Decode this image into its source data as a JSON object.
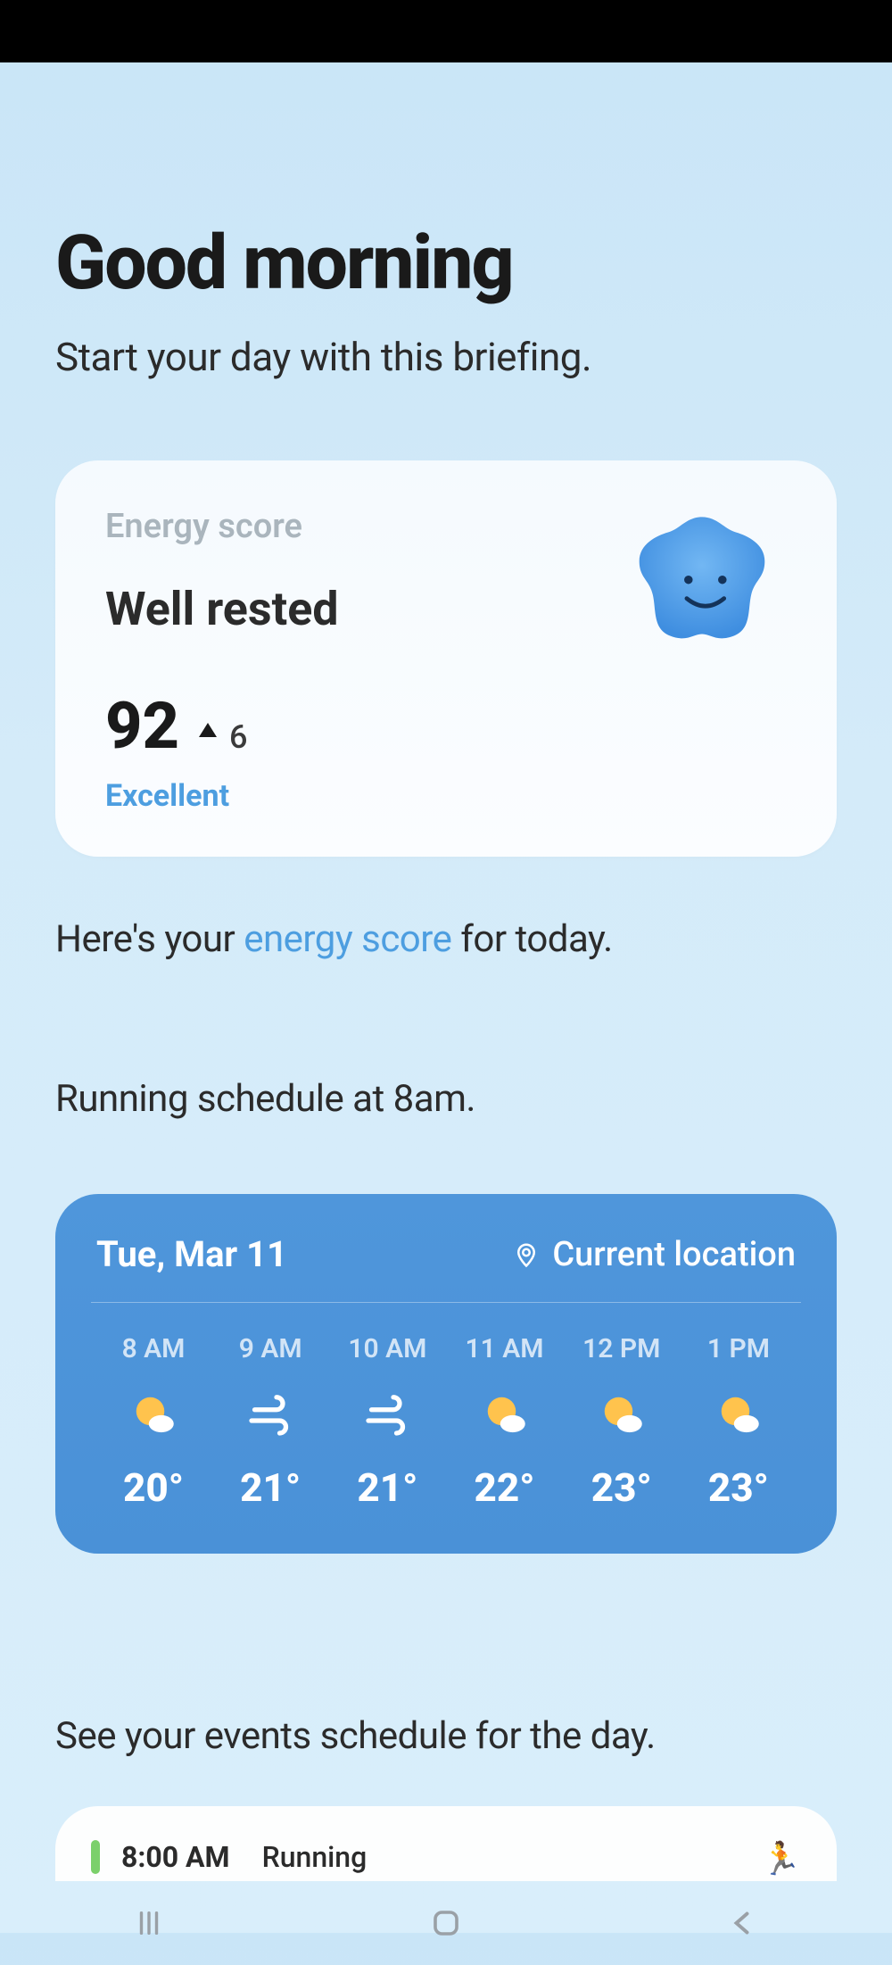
{
  "greeting": {
    "title": "Good morning",
    "subtitle": "Start your day with this briefing."
  },
  "energy_card": {
    "label": "Energy score",
    "title": "Well rested",
    "score": "92",
    "delta": "6",
    "rating": "Excellent"
  },
  "energy_line": {
    "prefix": "Here's your ",
    "link": "energy score",
    "suffix": " for today."
  },
  "running_line": "Running schedule at 8am.",
  "weather": {
    "date": "Tue, Mar 11",
    "location": "Current location",
    "hours": [
      {
        "label": "8 AM",
        "icon": "sun-cloud",
        "temp": "20°"
      },
      {
        "label": "9 AM",
        "icon": "wind",
        "temp": "21°"
      },
      {
        "label": "10 AM",
        "icon": "wind",
        "temp": "21°"
      },
      {
        "label": "11 AM",
        "icon": "sun-cloud",
        "temp": "22°"
      },
      {
        "label": "12 PM",
        "icon": "sun-cloud",
        "temp": "23°"
      },
      {
        "label": "1 PM",
        "icon": "sun-cloud",
        "temp": "23°"
      }
    ]
  },
  "events_line": {
    "prefix": "See your ",
    "link": "events schedule",
    "suffix": " for the day."
  },
  "event_peek": {
    "time": "8:00 AM",
    "title": "Running",
    "emoji": "🏃"
  }
}
